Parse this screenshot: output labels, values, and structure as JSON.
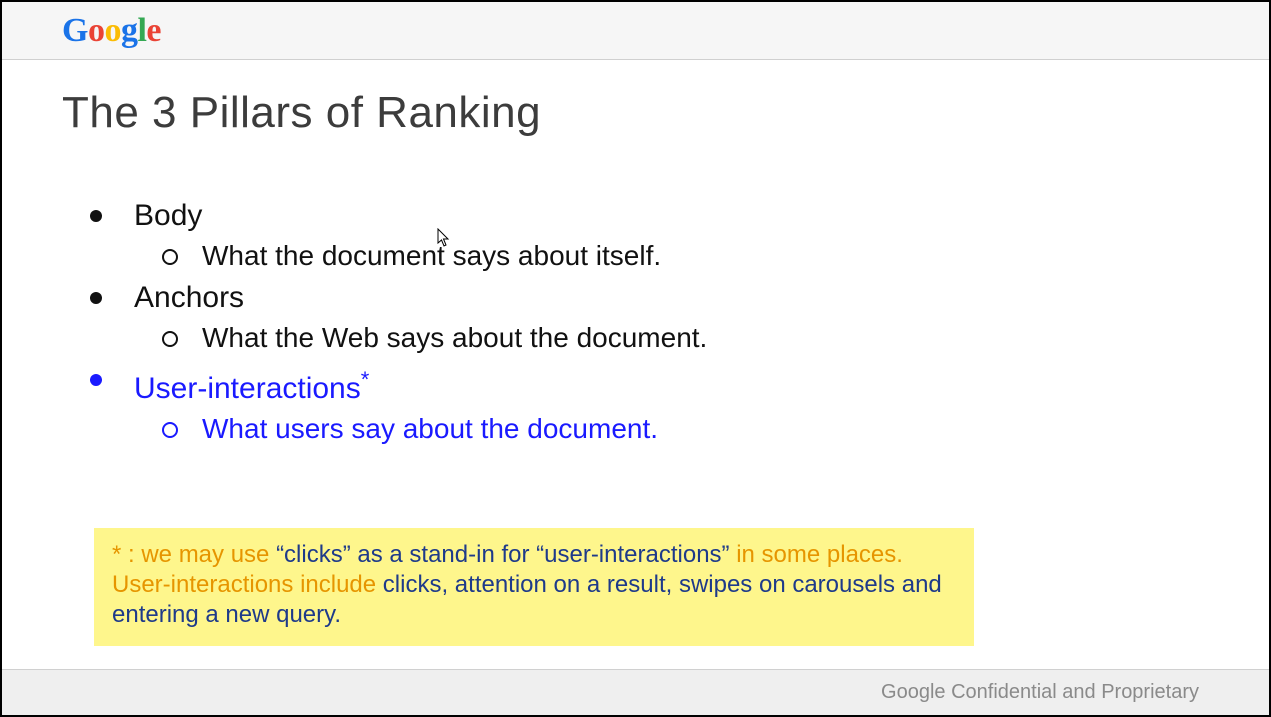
{
  "logo": {
    "g1": "G",
    "o1": "o",
    "o2": "o",
    "g2": "g",
    "l": "l",
    "e": "e"
  },
  "title": "The 3 Pillars of Ranking",
  "bullets": [
    {
      "label": "Body",
      "sub": "What the document says about itself.",
      "highlighted": false
    },
    {
      "label": "Anchors",
      "sub": "What the Web says about the document.",
      "highlighted": false
    },
    {
      "label": "User-interactions",
      "asterisk": "*",
      "sub": "What users say about the document.",
      "highlighted": true
    }
  ],
  "note": {
    "line1a": "* : we may use ",
    "line1b": "“clicks” as a stand-in for “user-interactions” ",
    "line1c": "in some places.",
    "line2a": "User-interactions include ",
    "line2b": "clicks, attention on a result, swipes on carousels and entering a new query."
  },
  "footer": "Google Confidential and Proprietary"
}
